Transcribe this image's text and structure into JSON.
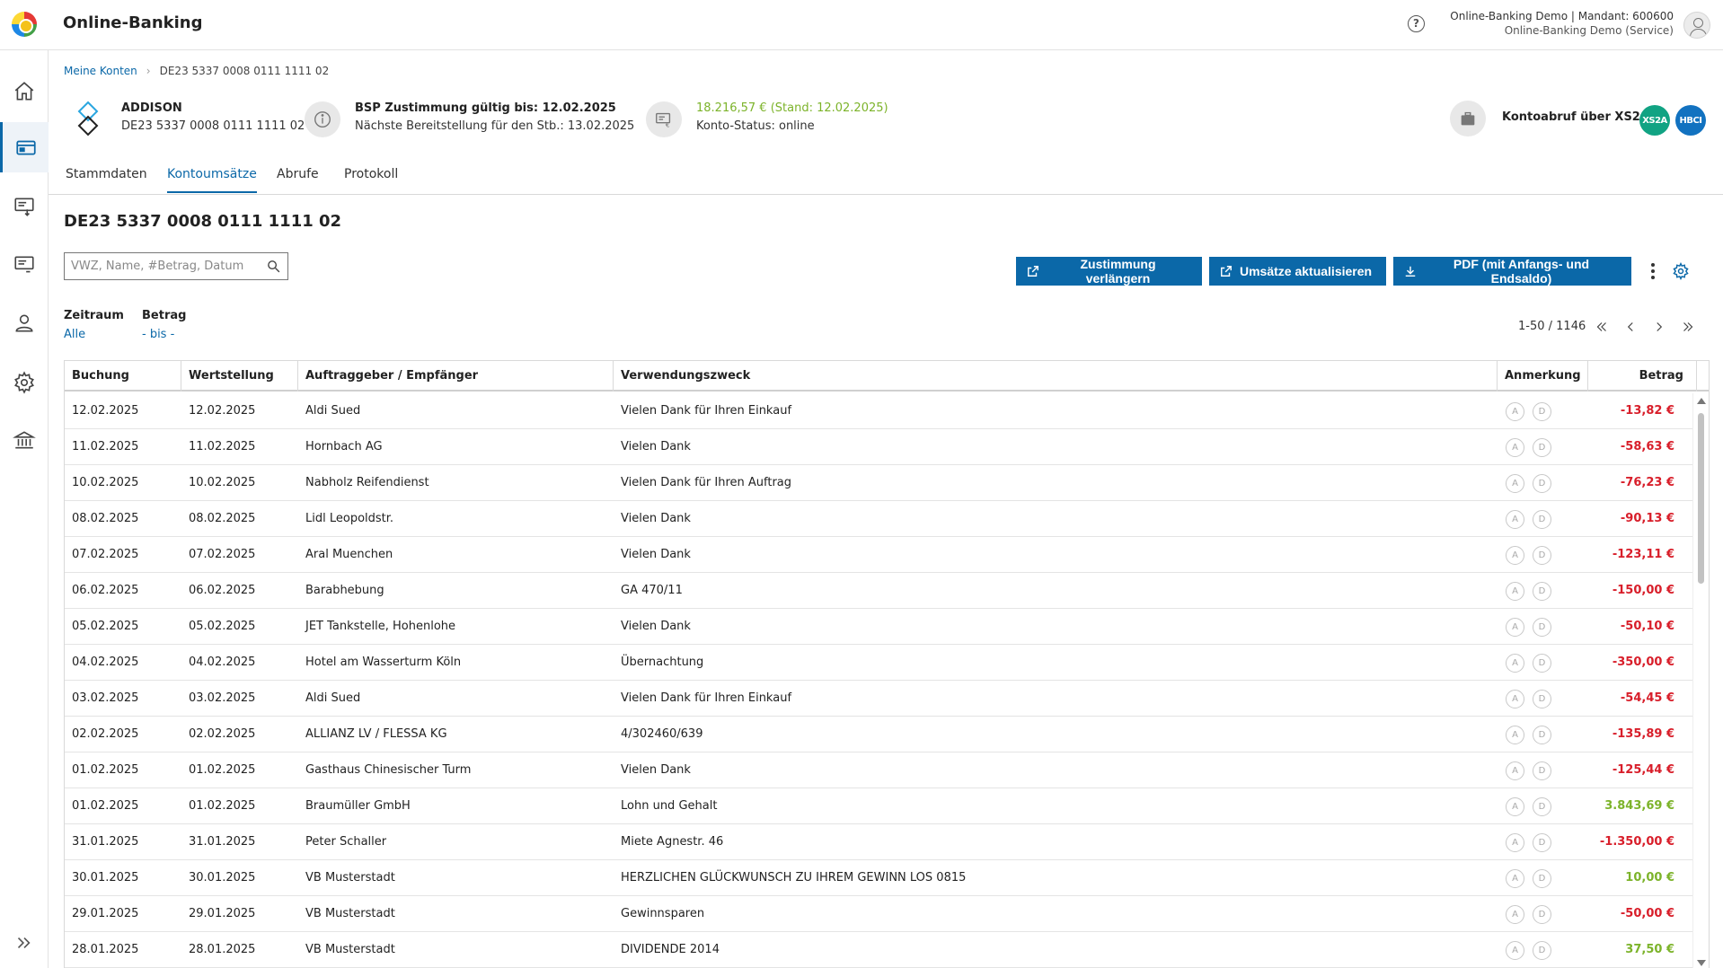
{
  "header": {
    "app_title": "Online-Banking",
    "user_line1": "Online-Banking Demo | Mandant: 600600",
    "user_line2": "Online-Banking Demo (Service)"
  },
  "breadcrumb": {
    "link": "Meine Konten",
    "separator": "›",
    "current": "DE23 5337 0008 0111 1111 02"
  },
  "account": {
    "name": "ADDISON",
    "iban": "DE23 5337 0008 0111 1111 02",
    "consent_title": "BSP Zustimmung gültig bis: 12.02.2025",
    "consent_sub": "Nächste Bereitstellung für den Stb.: 13.02.2025",
    "balance": "18.216,57 € (Stand: 12.02.2025)",
    "status": "Konto-Status: online",
    "kontoabruf": "Kontoabruf über XS2A",
    "badge_xs2a": "XS2A",
    "badge_hbci": "HBCI"
  },
  "tabs": [
    "Stammdaten",
    "Kontoumsätze",
    "Abrufe",
    "Protokoll"
  ],
  "section_title": "DE23 5337 0008 0111 1111 02",
  "search": {
    "placeholder": "VWZ, Name, #Betrag, Datum"
  },
  "buttons": {
    "extend": "Zustimmung verlängern",
    "refresh": "Umsätze aktualisieren",
    "pdf": "PDF (mit Anfangs- und Endsaldo)"
  },
  "filters": {
    "zeitraum_label": "Zeitraum",
    "zeitraum_value": "Alle",
    "betrag_label": "Betrag",
    "betrag_value": "- bis -"
  },
  "pagination": {
    "info": "1-50 / 1146"
  },
  "table": {
    "headers": [
      "Buchung",
      "Wertstellung",
      "Auftraggeber / Empfänger",
      "Verwendungszweck",
      "Anmerkung",
      "Betrag"
    ],
    "note_a": "A",
    "note_d": "D",
    "rows": [
      {
        "buchung": "12.02.2025",
        "wert": "12.02.2025",
        "name": "Aldi Sued",
        "zweck": "Vielen Dank für Ihren Einkauf",
        "betrag": "-13,82 €",
        "sign": "neg"
      },
      {
        "buchung": "11.02.2025",
        "wert": "11.02.2025",
        "name": "Hornbach AG",
        "zweck": "Vielen Dank",
        "betrag": "-58,63 €",
        "sign": "neg"
      },
      {
        "buchung": "10.02.2025",
        "wert": "10.02.2025",
        "name": "Nabholz Reifendienst",
        "zweck": "Vielen Dank für Ihren Auftrag",
        "betrag": "-76,23 €",
        "sign": "neg"
      },
      {
        "buchung": "08.02.2025",
        "wert": "08.02.2025",
        "name": "Lidl Leopoldstr.",
        "zweck": "Vielen Dank",
        "betrag": "-90,13 €",
        "sign": "neg"
      },
      {
        "buchung": "07.02.2025",
        "wert": "07.02.2025",
        "name": "Aral Muenchen",
        "zweck": "Vielen Dank",
        "betrag": "-123,11 €",
        "sign": "neg"
      },
      {
        "buchung": "06.02.2025",
        "wert": "06.02.2025",
        "name": "Barabhebung",
        "zweck": "GA 470/11",
        "betrag": "-150,00 €",
        "sign": "neg"
      },
      {
        "buchung": "05.02.2025",
        "wert": "05.02.2025",
        "name": "JET Tankstelle, Hohenlohe",
        "zweck": "Vielen Dank",
        "betrag": "-50,10 €",
        "sign": "neg"
      },
      {
        "buchung": "04.02.2025",
        "wert": "04.02.2025",
        "name": "Hotel am Wasserturm Köln",
        "zweck": "Übernachtung",
        "betrag": "-350,00 €",
        "sign": "neg"
      },
      {
        "buchung": "03.02.2025",
        "wert": "03.02.2025",
        "name": "Aldi Sued",
        "zweck": "Vielen Dank für Ihren Einkauf",
        "betrag": "-54,45 €",
        "sign": "neg"
      },
      {
        "buchung": "02.02.2025",
        "wert": "02.02.2025",
        "name": "ALLIANZ LV / FLESSA KG",
        "zweck": "4/302460/639",
        "betrag": "-135,89 €",
        "sign": "neg"
      },
      {
        "buchung": "01.02.2025",
        "wert": "01.02.2025",
        "name": "Gasthaus Chinesischer Turm",
        "zweck": "Vielen Dank",
        "betrag": "-125,44 €",
        "sign": "neg"
      },
      {
        "buchung": "01.02.2025",
        "wert": "01.02.2025",
        "name": "Braumüller GmbH",
        "zweck": "Lohn und Gehalt",
        "betrag": "3.843,69 €",
        "sign": "pos"
      },
      {
        "buchung": "31.01.2025",
        "wert": "31.01.2025",
        "name": "Peter Schaller",
        "zweck": "Miete Agnestr. 46",
        "betrag": "-1.350,00 €",
        "sign": "neg"
      },
      {
        "buchung": "30.01.2025",
        "wert": "30.01.2025",
        "name": "VB Musterstadt",
        "zweck": "HERZLICHEN GLÜCKWUNSCH ZU IHREM GEWINN LOS 0815",
        "betrag": "10,00 €",
        "sign": "pos"
      },
      {
        "buchung": "29.01.2025",
        "wert": "29.01.2025",
        "name": "VB Musterstadt",
        "zweck": "Gewinnsparen",
        "betrag": "-50,00 €",
        "sign": "neg"
      },
      {
        "buchung": "28.01.2025",
        "wert": "28.01.2025",
        "name": "VB Musterstadt",
        "zweck": "DIVIDENDE 2014",
        "betrag": "37,50 €",
        "sign": "pos"
      }
    ]
  },
  "colors": {
    "accent": "#0b68a8",
    "negative": "#d81e2a",
    "positive": "#7cb32a"
  }
}
